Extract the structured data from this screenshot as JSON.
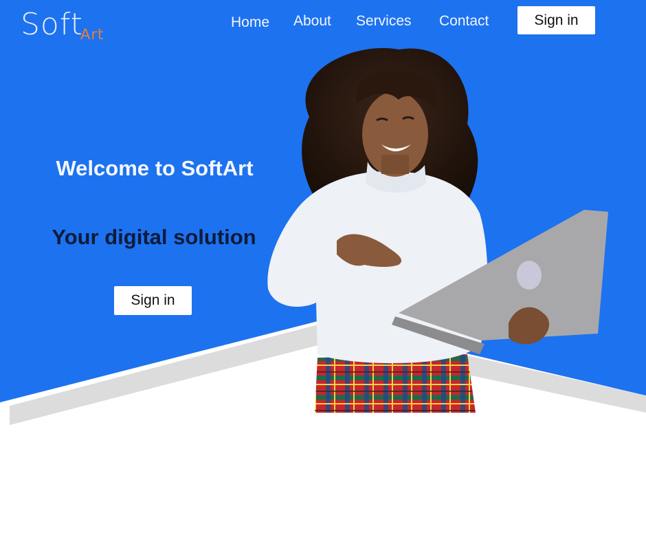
{
  "brand": {
    "name_main": "Soft",
    "name_sub": "Art",
    "primary_color": "#1d72ef",
    "accent_color": "#f07c3a"
  },
  "nav": {
    "items": [
      {
        "label": "Home"
      },
      {
        "label": "About"
      },
      {
        "label": "Services"
      },
      {
        "label": "Contact"
      }
    ],
    "signin_label": "Sign in"
  },
  "hero": {
    "title": "Welcome to SoftArt",
    "subtitle": "Your digital solution",
    "signin_label": "Sign in",
    "image": "woman-holding-laptop"
  }
}
